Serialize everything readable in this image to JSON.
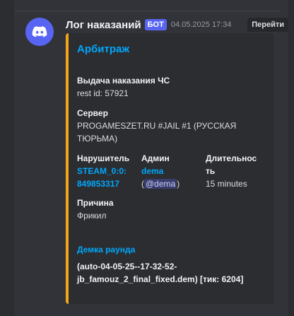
{
  "message": {
    "author": "Лог наказаний",
    "bot_tag": "БОТ",
    "timestamp": "04.05.2025 17:34",
    "goto_button": "Перейти"
  },
  "embed": {
    "accent_color": "#f6a41a",
    "title": "Арбитраж",
    "punishment": {
      "name": "Выдача наказания ЧС",
      "value": "rest id: 57921"
    },
    "server": {
      "name": "Сервер",
      "value_line1": "PROGAMESZET.RU #JAIL #1 (РУССКАЯ",
      "value_line2": "ТЮРЬМА)"
    },
    "violator": {
      "name": "Нарушитель",
      "value_line1": "STEAM_0:0:",
      "value_line2": "849853317"
    },
    "admin": {
      "name": "Админ",
      "value": "dema",
      "mention_open": "(",
      "mention": "@dema",
      "mention_close": ")"
    },
    "duration": {
      "name_line1": "Длительнос",
      "name_line2": "ть",
      "value": "15 minutes"
    },
    "reason": {
      "name": "Причина",
      "value": "Фрикил"
    },
    "demo": {
      "title": "Демка раунда",
      "value_line1": "(auto-04-05-25--17-32-52-",
      "value_line2": "jb_famouz_2_final_fixed.dem) [тик: 6204]"
    }
  },
  "icons": {
    "avatar": "discord-logo-icon"
  },
  "colors": {
    "link": "#00a8fc",
    "bot_tag": "#5865f2",
    "background": "#323339"
  }
}
